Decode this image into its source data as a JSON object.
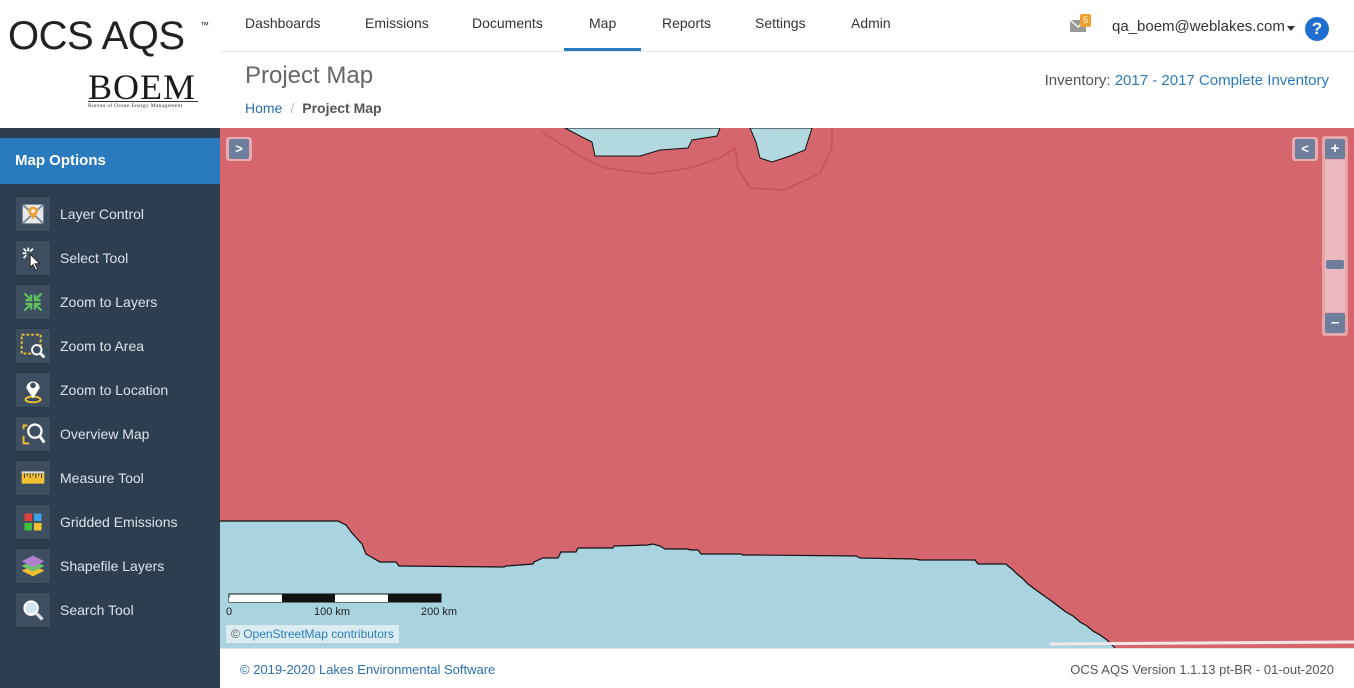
{
  "logo": {
    "app_name": "OCS AQS",
    "tm": "™",
    "org": "BOEM",
    "org_full": "Bureau of Ocean Energy Management"
  },
  "nav": {
    "items": [
      "Dashboards",
      "Emissions",
      "Documents",
      "Map",
      "Reports",
      "Settings",
      "Admin"
    ],
    "active": "Map",
    "notifications": "5",
    "user": "qa_boem@weblakes.com",
    "help": "?"
  },
  "header": {
    "title": "Project Map",
    "breadcrumb": {
      "home": "Home",
      "separator": "/",
      "current": "Project Map"
    },
    "inventory_label": "Inventory:",
    "inventory_value": "2017 - 2017 Complete Inventory"
  },
  "sidebar": {
    "title": "Map Options",
    "tools": [
      {
        "label": "Layer Control",
        "icon": "layer-control-icon"
      },
      {
        "label": "Select Tool",
        "icon": "select-tool-icon"
      },
      {
        "label": "Zoom to Layers",
        "icon": "zoom-to-layers-icon"
      },
      {
        "label": "Zoom to Area",
        "icon": "zoom-to-area-icon"
      },
      {
        "label": "Zoom to Location",
        "icon": "zoom-to-location-icon"
      },
      {
        "label": "Overview Map",
        "icon": "overview-map-icon"
      },
      {
        "label": "Measure Tool",
        "icon": "measure-tool-icon"
      },
      {
        "label": "Gridded Emissions",
        "icon": "gridded-emissions-icon"
      },
      {
        "label": "Shapefile Layers",
        "icon": "shapefile-layers-icon"
      },
      {
        "label": "Search Tool",
        "icon": "search-tool-icon"
      }
    ]
  },
  "map": {
    "open_panel": ">",
    "close_panel": "<",
    "zoom_in": "+",
    "zoom_out": "–",
    "scale_labels": [
      "0",
      "100 km",
      "200 km"
    ],
    "attribution_prefix": "©",
    "attribution_link": "OpenStreetMap contributors",
    "colors": {
      "area": "#d6666e",
      "water": "#a9d3df"
    }
  },
  "footer": {
    "copyright": "© 2019-2020 Lakes Environmental Software",
    "version": "OCS AQS Version 1.1.13 pt-BR - 01-out-2020"
  }
}
